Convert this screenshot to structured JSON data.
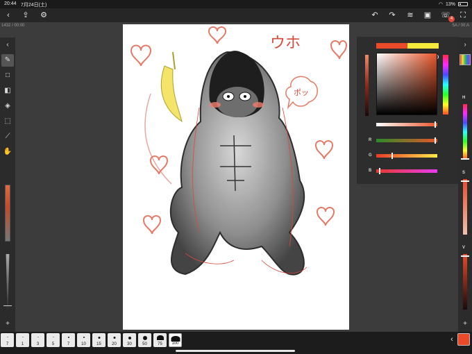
{
  "status": {
    "time": "20:44",
    "date": "7月24日(土)",
    "battery": "13%"
  },
  "toolbar": {
    "notif_count": "4"
  },
  "infobar": {
    "left": "1432 / 00:00",
    "right": "5A / 00:A"
  },
  "color_panel": {
    "labels": [
      "R",
      "G",
      "B"
    ],
    "primary_color": "#e84a2a",
    "secondary_color": "#f6ea3c"
  },
  "right_panel": {
    "labels": [
      "H",
      "S",
      "V"
    ]
  },
  "brush_sizes": [
    "7",
    "1",
    "3",
    "5",
    "7",
    "10",
    "15",
    "20",
    "30",
    "50",
    "75",
    "100"
  ],
  "canvas": {
    "text_1": "ウホ",
    "text_2": "ポッ"
  },
  "icons": [
    "back-icon",
    "share-icon",
    "gear-icon",
    "undo-icon",
    "redo-icon",
    "layers-icon",
    "image-icon",
    "notification-icon",
    "fullscreen-icon"
  ]
}
